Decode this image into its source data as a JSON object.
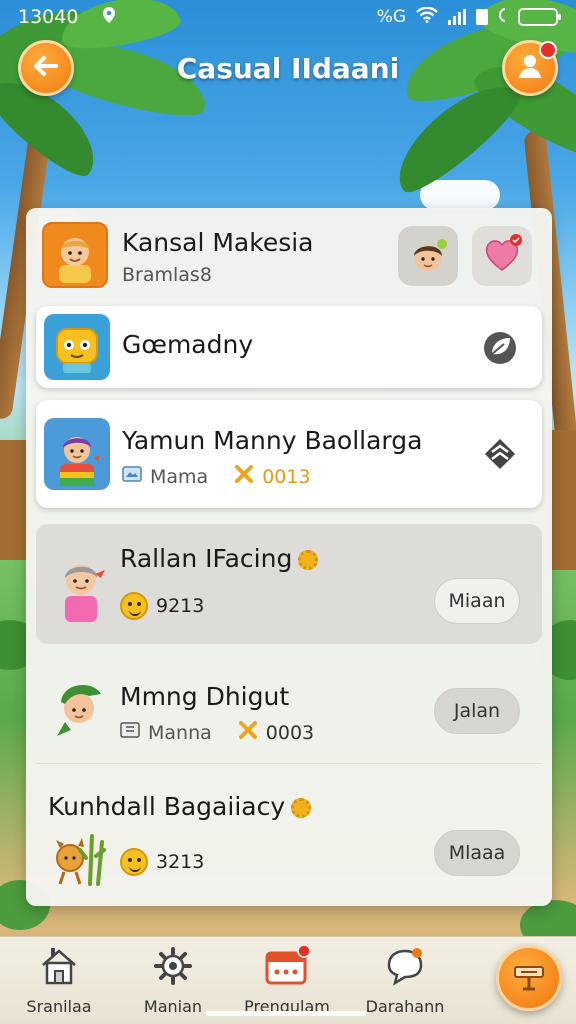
{
  "status_bar": {
    "time": "13040",
    "network": "%G"
  },
  "header": {
    "title": "Casual IIdaani"
  },
  "list": {
    "rows": [
      {
        "name": "Kansal Makesia",
        "sub": "Bramlas8"
      },
      {
        "name": "Gœmadny"
      },
      {
        "name": "Yamun Manny Baollarga",
        "sub_label": "Mama",
        "sub_value": "0013"
      },
      {
        "name": "Rallan IFacing",
        "score": "9213",
        "action": "Miaan"
      },
      {
        "name": "Mmng Dhigut",
        "sub_label": "Manna",
        "sub_value": "0003",
        "action": "Jalan"
      },
      {
        "name": "Kunhdall Bagaiiacy",
        "score": "3213",
        "action": "Mlaaa"
      }
    ]
  },
  "bottom_nav": {
    "items": [
      {
        "label": "Sranilaa",
        "icon": "house-icon"
      },
      {
        "label": "Manian",
        "icon": "gear-icon"
      },
      {
        "label": "Prengulam",
        "icon": "calendar-icon"
      },
      {
        "label": "Darahann",
        "icon": "chat-icon"
      }
    ]
  },
  "colors": {
    "accent": "#f07a12",
    "sky": "#2b8fd8",
    "panel": "#f4f4f0",
    "highlight_row": "#dddcd8",
    "score_orange": "#e59a12"
  }
}
